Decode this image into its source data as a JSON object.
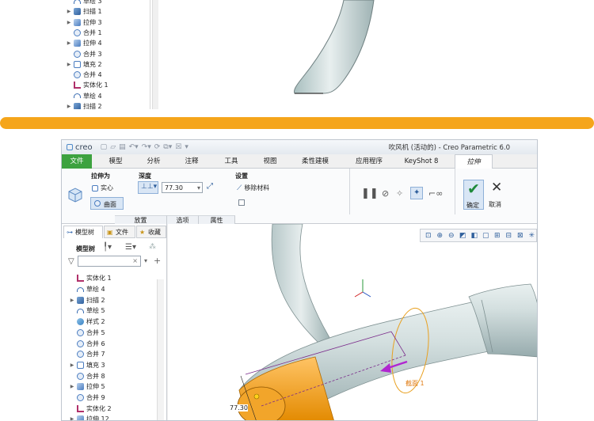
{
  "top_tree": [
    {
      "icon": "sketch",
      "label": "草绘 3",
      "twisty": ""
    },
    {
      "icon": "sweep",
      "label": "扫描 1",
      "twisty": "▶"
    },
    {
      "icon": "extrude",
      "label": "拉伸 3",
      "twisty": "▶"
    },
    {
      "icon": "merge",
      "label": "合并 1",
      "twisty": ""
    },
    {
      "icon": "extrude",
      "label": "拉伸 4",
      "twisty": "▶"
    },
    {
      "icon": "merge",
      "label": "合并 3",
      "twisty": ""
    },
    {
      "icon": "fill",
      "label": "填充 2",
      "twisty": "▶"
    },
    {
      "icon": "merge",
      "label": "合并 4",
      "twisty": ""
    },
    {
      "icon": "solid",
      "label": "实体化 1",
      "twisty": ""
    },
    {
      "icon": "sketch",
      "label": "草绘 4",
      "twisty": ""
    },
    {
      "icon": "sweep",
      "label": "扫描 2",
      "twisty": "▶"
    }
  ],
  "app": {
    "logo": "creo",
    "title": "吹风机 (活动的) - Creo Parametric 6.0",
    "tabs": [
      "文件",
      "模型",
      "分析",
      "注释",
      "工具",
      "视图",
      "柔性建模",
      "应用程序",
      "KeyShot 8",
      "拉伸"
    ]
  },
  "ribbon": {
    "extrude_as": "拉伸为",
    "solid": "实心",
    "surface": "曲面",
    "depth": "深度",
    "depth_value": "77.30",
    "settings": "设置",
    "remove_material": "移除材料",
    "ok": "确定",
    "cancel": "取消",
    "groups": [
      "放置",
      "选项",
      "属性"
    ]
  },
  "panel": {
    "tabs": [
      "模型树",
      "文件",
      "收藏"
    ],
    "model_tree_label": "模型树",
    "tree": [
      {
        "icon": "solid",
        "label": "实体化 1",
        "twisty": ""
      },
      {
        "icon": "sketch",
        "label": "草绘 4",
        "twisty": ""
      },
      {
        "icon": "sweep",
        "label": "扫描 2",
        "twisty": "▶"
      },
      {
        "icon": "sketch",
        "label": "草绘 5",
        "twisty": ""
      },
      {
        "icon": "style",
        "label": "样式 2",
        "twisty": ""
      },
      {
        "icon": "merge",
        "label": "合并 5",
        "twisty": ""
      },
      {
        "icon": "merge",
        "label": "合并 6",
        "twisty": ""
      },
      {
        "icon": "merge",
        "label": "合并 7",
        "twisty": ""
      },
      {
        "icon": "fill",
        "label": "填充 3",
        "twisty": "▶"
      },
      {
        "icon": "merge",
        "label": "合并 8",
        "twisty": ""
      },
      {
        "icon": "extrude",
        "label": "拉伸 5",
        "twisty": "▶"
      },
      {
        "icon": "merge",
        "label": "合并 9",
        "twisty": ""
      },
      {
        "icon": "solid",
        "label": "实体化 2",
        "twisty": ""
      },
      {
        "icon": "extrude",
        "label": "拉伸 12",
        "twisty": "▶"
      }
    ]
  },
  "viewport": {
    "section_label": "截面 1",
    "dimension_value": "77.30"
  }
}
